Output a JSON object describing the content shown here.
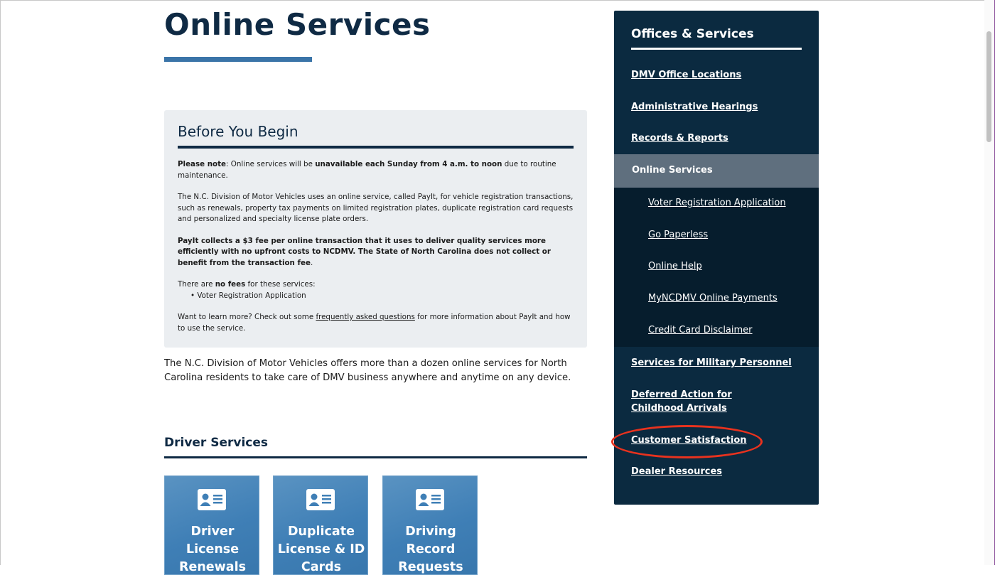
{
  "page": {
    "title": "Online Services"
  },
  "notice": {
    "title": "Before You Begin",
    "p1_label": "Please note",
    "p1_a": ": Online services will be ",
    "p1_bold": "unavailable each Sunday from 4 a.m. to noon",
    "p1_b": " due to routine maintenance.",
    "p2": "The N.C. Division of Motor Vehicles uses an online service, called PayIt, for vehicle registration transactions, such as renewals, property tax payments on limited registration plates, duplicate registration card requests and personalized and specialty license plate orders.",
    "p3_bold": "PayIt collects a $3 fee per online transaction that it uses to deliver quality services more efficiently with no upfront costs to NCDMV. The State of North Carolina does not collect or benefit from the transaction fee",
    "p3_end": ".",
    "p4_a": "There are ",
    "p4_bold": "no fees",
    "p4_b": " for these services:",
    "bullet": "• Voter Registration Application",
    "p5_a": "Want to learn more? Check out some ",
    "p5_link": "frequently asked questions",
    "p5_b": " for more information about PayIt and how to use the service."
  },
  "intro": "The N.C. Division of Motor Vehicles offers more than a dozen online services for North Carolina residents to take care of DMV business anywhere and anytime on any device.",
  "driver_services": {
    "title": "Driver Services",
    "tiles": [
      {
        "label": "Driver License Renewals",
        "icon": "id-card-icon"
      },
      {
        "label": "Duplicate License & ID Cards",
        "icon": "id-card-icon"
      },
      {
        "label": "Driving Record Requests",
        "icon": "id-card-icon"
      }
    ]
  },
  "sidebar": {
    "title": "Offices & Services",
    "items": [
      "DMV Office Locations",
      "Administrative Hearings",
      "Records & Reports"
    ],
    "active": "Online Services",
    "sub_items": [
      "Voter Registration Application",
      "Go Paperless",
      "Online Help",
      "MyNCDMV Online Payments",
      "Credit Card Disclaimer"
    ],
    "items_after": [
      "Services for Military Personnel",
      "Deferred Action for Childhood Arrivals",
      "Customer Satisfaction",
      "Dealer Resources"
    ]
  },
  "colors": {
    "navy": "#0f2a44",
    "accent_blue": "#3a74a8",
    "sidebar_bg": "#0b2a40",
    "active_bg": "#5f6f7e",
    "annotation_red": "#e8321e"
  }
}
